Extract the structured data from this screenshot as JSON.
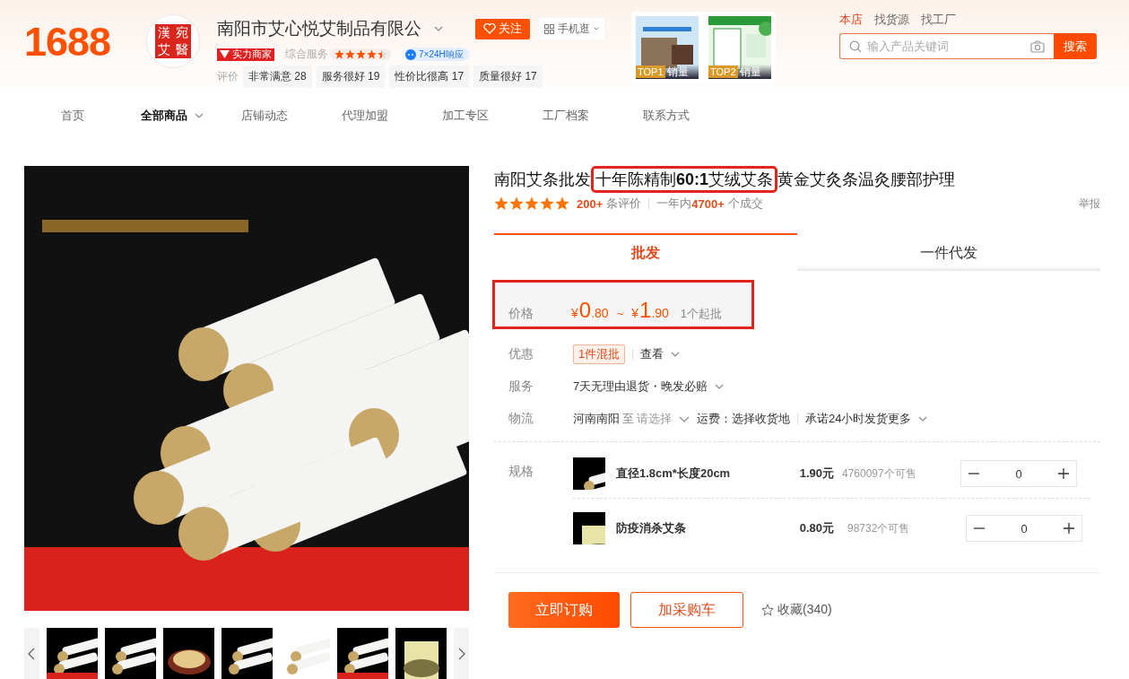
{
  "header": {
    "logo": "1688",
    "seal": [
      "漢",
      "宛",
      "艾",
      "醫"
    ],
    "shop_name": "南阳市艾心悦艾制品有限公",
    "follow_button": "关注",
    "mobile_button": "手机逛",
    "badge": "实力商家",
    "service": {
      "label": "综合服务",
      "stars": 4.5
    },
    "response_badge": "7×24H响应",
    "review_label": "评价",
    "review_tags": [
      {
        "label": "非常满意",
        "count": "28"
      },
      {
        "label": "服务很好",
        "count": "19"
      },
      {
        "label": "性价比很高",
        "count": "17"
      },
      {
        "label": "质量很好",
        "count": "17"
      }
    ],
    "top_products": [
      {
        "rank": "TOP1",
        "label": "销量"
      },
      {
        "rank": "TOP2",
        "label": "销量"
      }
    ],
    "search_scopes": [
      {
        "label": "本店",
        "selected": true
      },
      {
        "label": "找货源",
        "selected": false
      },
      {
        "label": "找工厂",
        "selected": false
      }
    ],
    "search": {
      "placeholder": "输入产品关键词",
      "button": "搜索"
    }
  },
  "nav": [
    {
      "label": "首页",
      "selected": false,
      "dropdown": false
    },
    {
      "label": "全部商品",
      "selected": true,
      "dropdown": true
    },
    {
      "label": "店铺动态",
      "selected": false,
      "dropdown": false
    },
    {
      "label": "代理加盟",
      "selected": false,
      "dropdown": false
    },
    {
      "label": "加工专区",
      "selected": false,
      "dropdown": false
    },
    {
      "label": "工厂档案",
      "selected": false,
      "dropdown": false
    },
    {
      "label": "联系方式",
      "selected": false,
      "dropdown": false
    }
  ],
  "product": {
    "title": [
      {
        "text": "南阳艾条批发",
        "highlighted": false
      },
      {
        "text": "十年陈精制**60:1**艾绒艾条",
        "highlighted": true
      },
      {
        "text": "黄金艾灸条温灸腰部护理",
        "highlighted": false
      }
    ],
    "stars": 5,
    "review_count": "200+",
    "review_unit": "条评价",
    "sales_prefix": "一年内",
    "sales_count": "4700+",
    "sales_unit": "个成交",
    "report": "举报",
    "tabs": [
      {
        "label": "批发",
        "selected": true
      },
      {
        "label": "一件代发",
        "selected": false
      }
    ],
    "price": {
      "label": "价格",
      "highlighted": true,
      "low": {
        "symbol": "¥",
        "integer": "0",
        "decimal": ".80"
      },
      "separator": "~",
      "high": {
        "symbol": "¥",
        "integer": "1",
        "decimal": ".90"
      },
      "moq": "1个起批"
    },
    "discount": {
      "label": "优惠",
      "tag": "1件混批",
      "link": "查看"
    },
    "service": {
      "label": "服务",
      "text": "7天无理由退货・晚发必赔"
    },
    "logistics": {
      "label": "物流",
      "origin": "河南南阳",
      "to": "至",
      "destination": "请选择",
      "fee": "运费：选择收货地",
      "promise": "承诺24小时发货",
      "more": "更多"
    },
    "specs": {
      "label": "规格",
      "items": [
        {
          "name": "直径1.8cm*长度20cm",
          "price": "1.90元",
          "stock": "4760097个可售",
          "quantity": "0"
        },
        {
          "name": "防疫消杀艾条",
          "price": "0.80元",
          "stock": "98732个可售",
          "quantity": "0"
        }
      ]
    },
    "actions": {
      "buy": "立即订购",
      "cart": "加采购车",
      "favorite": "收藏(340)"
    }
  }
}
